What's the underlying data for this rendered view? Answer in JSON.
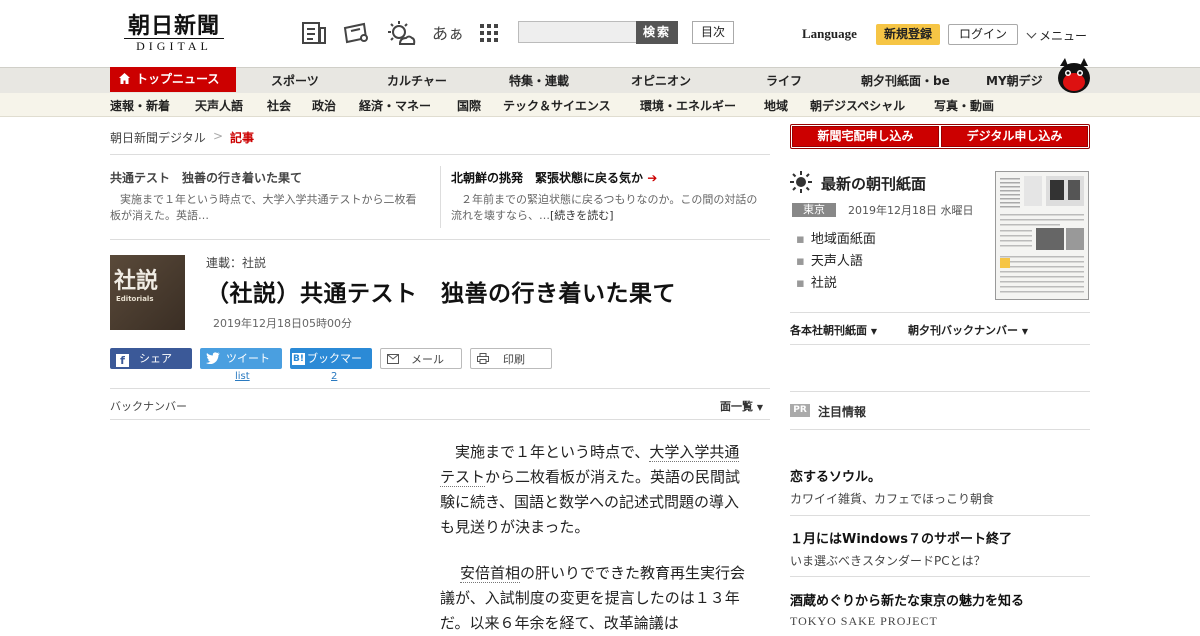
{
  "header": {
    "logo_jp": "朝日新聞",
    "logo_en": "DIGITAL",
    "icons": [
      "news-icon",
      "ticket-icon",
      "weather-icon",
      "font-size-icon",
      "apps-icon"
    ],
    "font_size_label": "あぁ",
    "search_placeholder": "",
    "search_button": "検索",
    "toc_button": "目次",
    "language": "Language",
    "register": "新規登録",
    "login": "ログイン",
    "menu": "メニュー"
  },
  "nav_primary": {
    "top_news": "トップニュース",
    "items": [
      "スポーツ",
      "カルチャー",
      "特集・連載",
      "オピニオン",
      "ライフ",
      "朝夕刊紙面・be",
      "MY朝デジ"
    ]
  },
  "nav_secondary": [
    "速報・新着",
    "天声人語",
    "社会",
    "政治",
    "経済・マネー",
    "国際",
    "テック＆サイエンス",
    "環境・エネルギー",
    "地域",
    "朝デジスペシャル",
    "写真・動画"
  ],
  "breadcrumb": {
    "home": "朝日新聞デジタル",
    "sep": ">",
    "current": "記事"
  },
  "related": [
    {
      "title": "共通テスト　独善の行き着いた果て",
      "body": "実施まで１年という時点で、大学入学共通テストから二枚看板が消えた。英語…"
    },
    {
      "title": "北朝鮮の挑発　緊張状態に戻る気か",
      "arrow": "➔",
      "body": "２年前までの緊迫状態に戻るつもりなのか。この間の対話の流れを壊すなら、…",
      "more": "[続きを読む]"
    }
  ],
  "article": {
    "thumb_jp": "社説",
    "thumb_en": "Editorials",
    "kicker": "連載：社説",
    "headline": "（社説）共通テスト　独善の行き着いた果て",
    "date": "2019年12月18日05時00分",
    "share": {
      "facebook": "シェア",
      "twitter": "ツイート",
      "twitter_count": "list",
      "hatena": "ブックマーク",
      "hatena_count": "2",
      "mail": "メール",
      "print": "印刷"
    },
    "backnumber": "バックナンバー",
    "list_menu": "面一覧",
    "p1": {
      "indent": "実施まで１年という時点で、",
      "link": "大学入学共通テスト",
      "rest": "から二枚看板が消えた。英語の民間試験に続き、国語と数学への記述式問題の導入も見送りが決まった。"
    },
    "p2": {
      "link": "安倍首相",
      "rest": "の肝いりでできた教育再生実行会議が、入試制度の変更を提言したのは１３年だ。以来６年余を経て、改革論議は"
    }
  },
  "sidebar": {
    "btn_home_delivery": "新聞宅配申し込み",
    "btn_digital": "デジタル申し込み",
    "paper_title": "最新の朝刊紙面",
    "paper_region": "東京",
    "paper_date": "2019年12月18日 水曜日",
    "paper_links": [
      "地域面紙面",
      "天声人語",
      "社説"
    ],
    "sub_links": [
      "各本社朝刊紙面",
      "朝夕刊バックナンバー"
    ],
    "pr_badge": "PR",
    "pr_heading": "注目情報",
    "pr_items": [
      {
        "title": "恋するソウル。",
        "sub": "カワイイ雑貨、カフェでほっこり朝食"
      },
      {
        "title": "１月にはWindows７のサポート終了",
        "sub": "いま選ぶべきスタンダードPCとは？"
      },
      {
        "title": "酒蔵めぐりから新たな東京の魅力を知る",
        "sub": "TOKYO SAKE PROJECT"
      }
    ]
  },
  "colors": {
    "brand_red": "#c00",
    "register_yellow": "#f6c545",
    "nav_bg": "#e8e7e2"
  }
}
